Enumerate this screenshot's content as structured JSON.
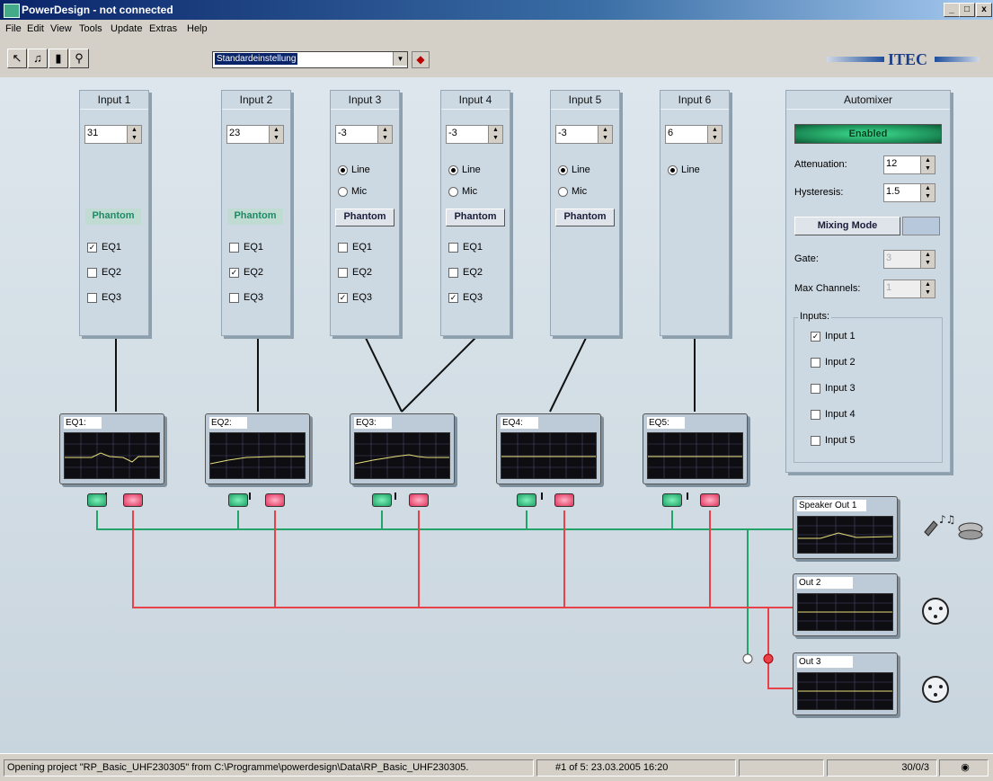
{
  "window": {
    "title": "PowerDesign - not connected",
    "min_label": "_",
    "max_label": "□",
    "close_label": "x"
  },
  "menu": [
    "File",
    "Edit",
    "View",
    "Tools",
    "Update",
    "Extras",
    "Help"
  ],
  "toolbar": {
    "preset_value": "Standardeinstellung",
    "logo_text": "ITEC"
  },
  "inputs": [
    {
      "title": "Input 1",
      "value": "31",
      "radio": [],
      "phantom": "Phantom",
      "phantom_active": true,
      "eq": [
        {
          "label": "EQ1",
          "checked": true
        },
        {
          "label": "EQ2",
          "checked": false
        },
        {
          "label": "EQ3",
          "checked": false
        }
      ]
    },
    {
      "title": "Input 2",
      "value": "23",
      "radio": [],
      "phantom": "Phantom",
      "phantom_active": true,
      "eq": [
        {
          "label": "EQ1",
          "checked": false
        },
        {
          "label": "EQ2",
          "checked": true
        },
        {
          "label": "EQ3",
          "checked": false
        }
      ]
    },
    {
      "title": "Input 3",
      "value": "-3",
      "radio": [
        {
          "label": "Line",
          "on": true
        },
        {
          "label": "Mic",
          "on": false
        }
      ],
      "phantom": "Phantom",
      "phantom_active": false,
      "eq": [
        {
          "label": "EQ1",
          "checked": false
        },
        {
          "label": "EQ2",
          "checked": false
        },
        {
          "label": "EQ3",
          "checked": true
        }
      ]
    },
    {
      "title": "Input 4",
      "value": "-3",
      "radio": [
        {
          "label": "Line",
          "on": true
        },
        {
          "label": "Mic",
          "on": false
        }
      ],
      "phantom": "Phantom",
      "phantom_active": false,
      "eq": [
        {
          "label": "EQ1",
          "checked": false
        },
        {
          "label": "EQ2",
          "checked": false
        },
        {
          "label": "EQ3",
          "checked": true
        }
      ]
    },
    {
      "title": "Input 5",
      "value": "-3",
      "radio": [
        {
          "label": "Line",
          "on": true
        },
        {
          "label": "Mic",
          "on": false
        }
      ],
      "phantom": "Phantom",
      "phantom_active": false,
      "eq": []
    },
    {
      "title": "Input 6",
      "value": "6",
      "radio": [
        {
          "label": "Line",
          "on": true
        }
      ],
      "phantom": "",
      "phantom_active": false,
      "eq": []
    }
  ],
  "automixer": {
    "title": "Automixer",
    "enabled_label": "Enabled",
    "attenuation_label": "Attenuation:",
    "attenuation_value": "12",
    "hysteresis_label": "Hysteresis:",
    "hysteresis_value": "1.5",
    "mixing_mode_label": "Mixing Mode",
    "gate_label": "Gate:",
    "gate_value": "3",
    "max_channels_label": "Max Channels:",
    "max_channels_value": "1",
    "inputs_group_label": "Inputs:",
    "inputs": [
      {
        "label": "Input 1",
        "checked": true
      },
      {
        "label": "Input 2",
        "checked": false
      },
      {
        "label": "Input 3",
        "checked": false
      },
      {
        "label": "Input 4",
        "checked": false
      },
      {
        "label": "Input 5",
        "checked": false
      }
    ]
  },
  "eqs": [
    "EQ1:",
    "EQ2:",
    "EQ3:",
    "EQ4:",
    "EQ5:"
  ],
  "outputs": [
    "Speaker Out 1",
    "Out 2",
    "Out 3"
  ],
  "colors": {
    "bus_green": "#22a36a",
    "bus_red": "#e8414a",
    "wire_black": "#111111"
  },
  "status": {
    "message": "Opening project \"RP_Basic_UHF230305\" from C:\\Programme\\powerdesign\\Data\\RP_Basic_UHF230305.",
    "snapshot": "#1 of 5: 23.03.2005 16:20",
    "counter": "30/0/3"
  }
}
